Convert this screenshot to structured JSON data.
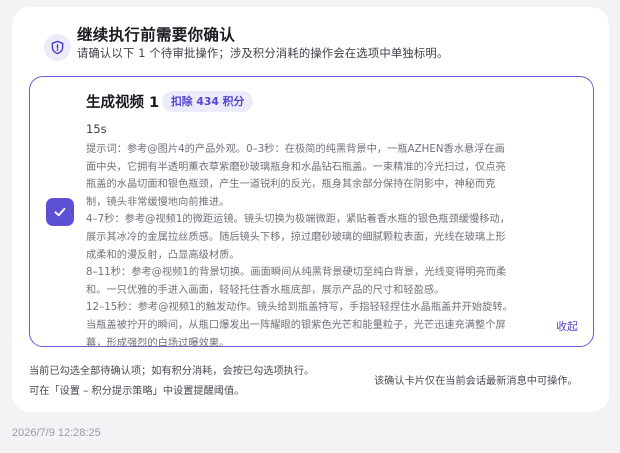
{
  "header": {
    "icon": "shield-icon",
    "title": "继续执行前需要你确认",
    "subtitle": "请确认以下 1 个待审批操作；涉及积分消耗的操作会在选项中单独标明。"
  },
  "card": {
    "checked": true,
    "title": "生成视频 1",
    "badge": "扣除 434 积分",
    "duration": "15s",
    "prompt": "提示词：参考@图片4的产品外观。0–3秒：在极简的纯黑背景中，一瓶AZHEN香水悬浮在画\n面中央，它拥有半透明薰衣草紫磨砂玻璃瓶身和水晶钻石瓶盖。一束精准的冷光扫过，仅点亮\n瓶盖的水晶切面和银色瓶颈，产生一道锐利的反光，瓶身其余部分保持在阴影中，神秘而克\n制，镜头非常缓慢地向前推进。\n4–7秒：参考@视频1的微距运镜。镜头切换为极端微距，紧贴着香水瓶的银色瓶颈缓慢移动，\n展示其冰冷的金属拉丝质感。随后镜头下移，掠过磨砂玻璃的细腻颗粒表面，光线在玻璃上形\n成柔和的漫反射，凸显高级材质。\n8–11秒：参考@视频1的背景切换。画面瞬间从纯黑背景硬切至纯白背景，光线变得明亮而柔\n和。一只优雅的手进入画面，轻轻托住香水瓶底部，展示产品的尺寸和轻盈感。\n12–15秒：参考@视频1的触发动作。镜头给到瓶盖特写，手指轻轻捏住水晶瓶盖并开始旋转。\n当瓶盖被拧开的瞬间，从瓶口爆发出一阵耀眼的银紫色光芒和能量粒子，光芒迅速充满整个屏\n幕，形成强烈的白场过曝效果。",
    "collapse_label": "收起"
  },
  "footer": {
    "line1": "当前已勾选全部待确认项；如有积分消耗，会按已勾选项执行。",
    "line2": "可在「设置 – 积分提示策略」中设置提醒阈值。",
    "right": "该确认卡片仅在当前会话最新消息中可操作。"
  },
  "timestamp": "2026/7/9 12:28:25",
  "colors": {
    "accent": "#5b4fd4",
    "badge_bg": "#ecebfb",
    "page_bg": "#f3f3f6"
  }
}
